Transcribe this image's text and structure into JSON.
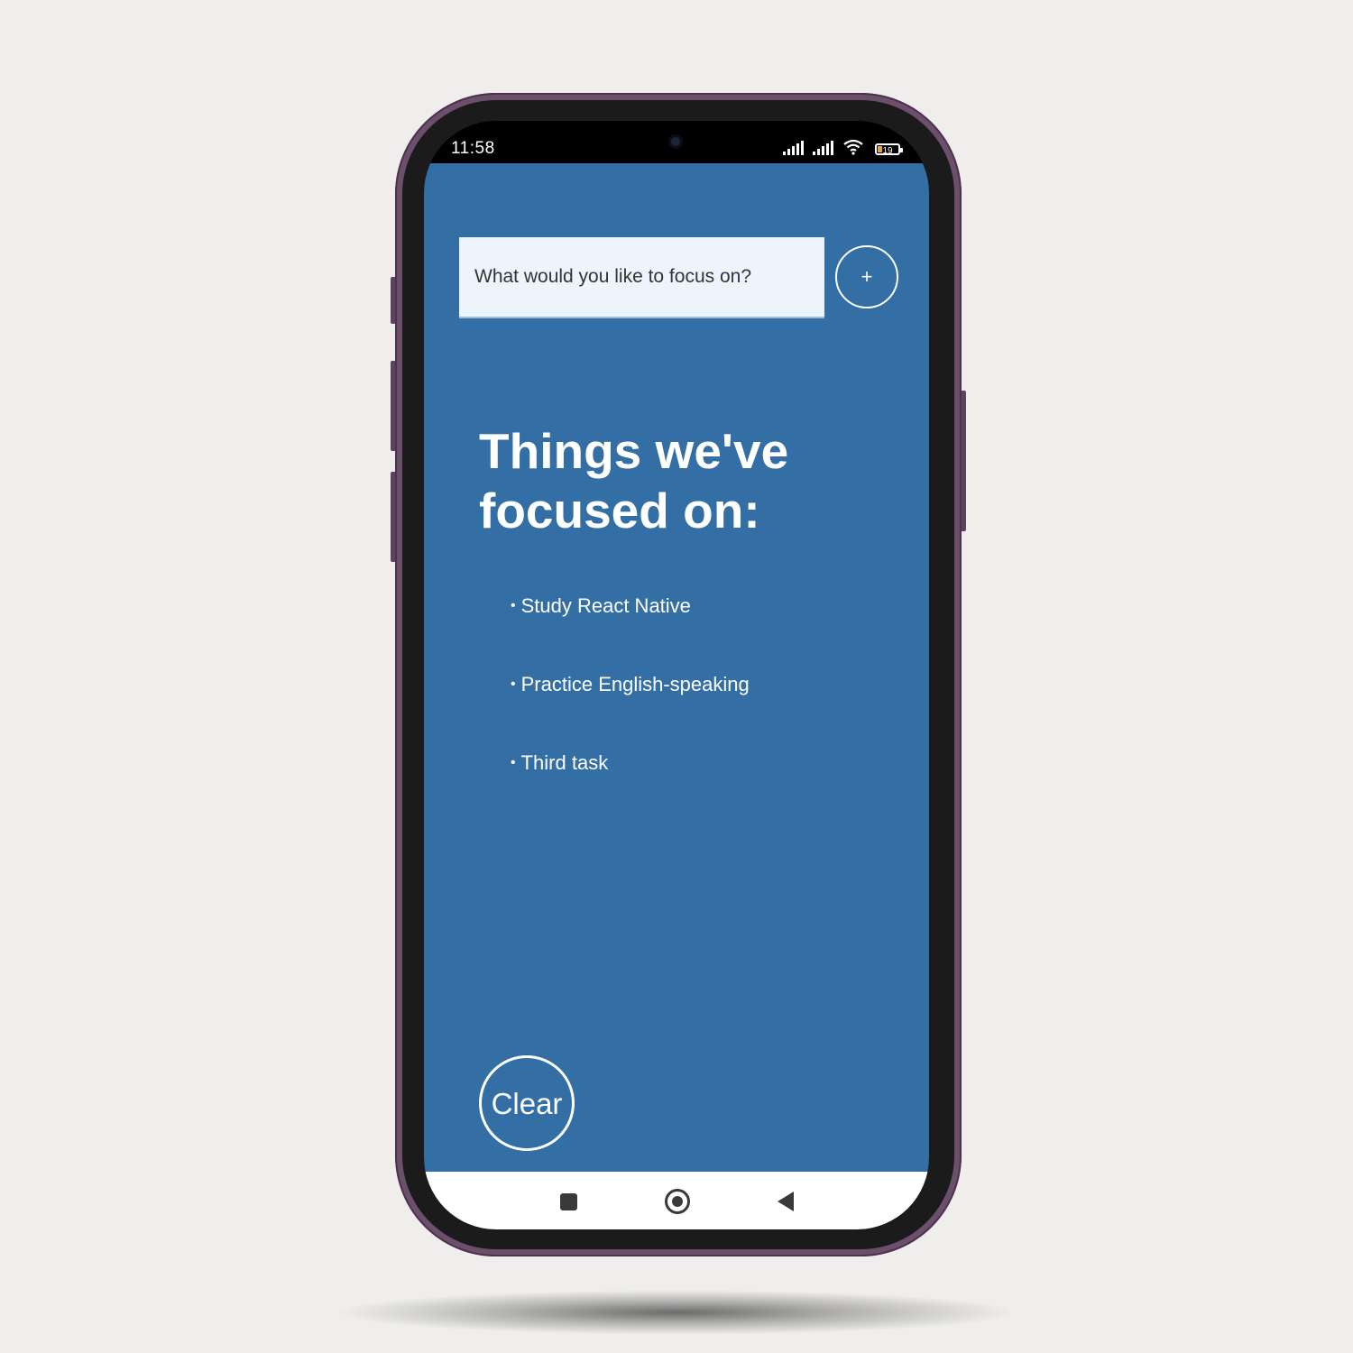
{
  "status_bar": {
    "time": "11:58",
    "battery_level": "19",
    "icons": [
      "signal-icon",
      "signal-icon",
      "wifi-icon",
      "battery-icon"
    ]
  },
  "colors": {
    "app_background": "#336fa5",
    "input_background": "#eef4fc",
    "text_on_app": "#ffffff"
  },
  "input": {
    "placeholder": "What would you like to focus on?",
    "value": ""
  },
  "add_button": {
    "label": "+"
  },
  "heading": "Things we've focused on:",
  "tasks": [
    {
      "bullet": "•",
      "label": "Study React Native"
    },
    {
      "bullet": "•",
      "label": "Practice English-speaking"
    },
    {
      "bullet": "•",
      "label": "Third task"
    }
  ],
  "clear_button": {
    "label": "Clear"
  },
  "nav_bar": {
    "icons": [
      "recent-apps-icon",
      "home-icon",
      "back-icon"
    ]
  }
}
